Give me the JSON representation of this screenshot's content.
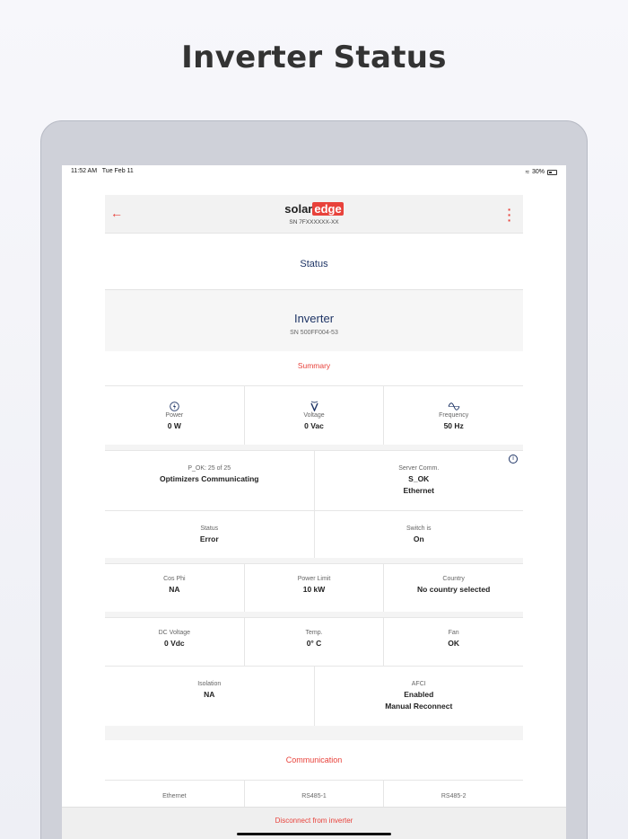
{
  "headline": "Inverter Status",
  "statusbar": {
    "time": "11:52 AM",
    "date": "Tue Feb 11",
    "battery": "30%"
  },
  "nav": {
    "logo_solar": "solar",
    "logo_edge": "edge",
    "sn": "SN 7FXXXXXX-XX"
  },
  "status_title": "Status",
  "inverter": {
    "name": "Inverter",
    "sn": "SN 500FF004-53"
  },
  "summary_title": "Summary",
  "summary": [
    {
      "icon": "power-icon",
      "label": "Power",
      "value": "0 W"
    },
    {
      "icon": "voltage-icon",
      "label": "Voltage",
      "value": "0 Vac"
    },
    {
      "icon": "frequency-icon",
      "label": "Frequency",
      "value": "50 Hz"
    }
  ],
  "optimizers": {
    "label": "P_OK: 25 of 25",
    "value": "Optimizers Communicating"
  },
  "server": {
    "label": "Server Comm.",
    "value": "S_OK",
    "value2": "Ethernet"
  },
  "status_row": [
    {
      "label": "Status",
      "value": "Error"
    },
    {
      "label": "Switch is",
      "value": "On"
    }
  ],
  "params_row1": [
    {
      "label": "Cos Phi",
      "value": "NA"
    },
    {
      "label": "Power Limit",
      "value": "10 kW"
    },
    {
      "label": "Country",
      "value": "No country selected"
    }
  ],
  "params_row2": [
    {
      "label": "DC Voltage",
      "value": "0 Vdc"
    },
    {
      "label": "Temp.",
      "value": "0° C"
    },
    {
      "label": "Fan",
      "value": "OK"
    }
  ],
  "isolation": {
    "label": "Isolation",
    "value": "NA"
  },
  "afci": {
    "label": "AFCI",
    "value": "Enabled",
    "value2": "Manual Reconnect"
  },
  "communication_title": "Communication",
  "comm_row": [
    "Ethernet",
    "RS485-1",
    "RS485-2"
  ],
  "disconnect_label": "Disconnect from inverter",
  "colors": {
    "accent": "#e8423b",
    "navy": "#1f3566",
    "device": "#cfd1d9"
  }
}
